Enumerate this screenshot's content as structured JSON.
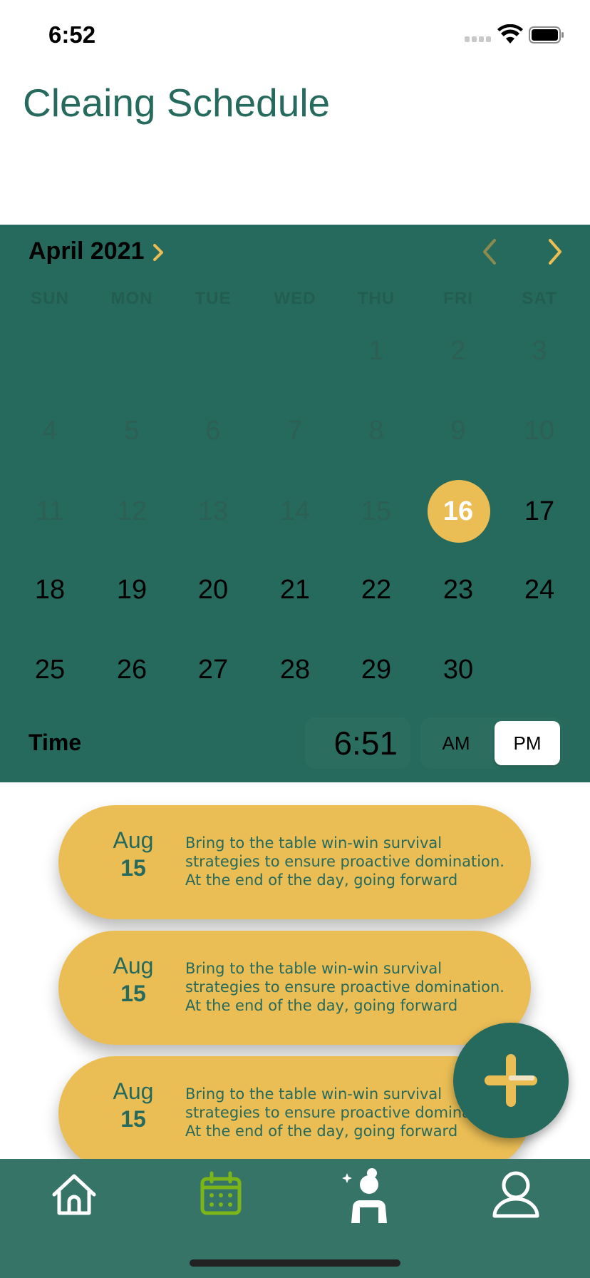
{
  "status_bar": {
    "time": "6:52"
  },
  "page_title": "Cleaing Schedule",
  "calendar": {
    "month_label": "April 2021",
    "weekdays": [
      "SUN",
      "MON",
      "TUE",
      "WED",
      "THU",
      "FRI",
      "SAT"
    ],
    "selected_day": "16",
    "weeks": [
      [
        "",
        "",
        "",
        "",
        "1",
        "2",
        "3"
      ],
      [
        "4",
        "5",
        "6",
        "7",
        "8",
        "9",
        "10"
      ],
      [
        "11",
        "12",
        "13",
        "14",
        "15",
        "16",
        "17"
      ],
      [
        "18",
        "19",
        "20",
        "21",
        "22",
        "23",
        "24"
      ],
      [
        "25",
        "26",
        "27",
        "28",
        "29",
        "30",
        ""
      ]
    ],
    "time_label": "Time",
    "time_value": "6:51",
    "am_label": "AM",
    "pm_label": "PM",
    "selected_period": "PM"
  },
  "tasks": [
    {
      "month": "Aug",
      "day": "15",
      "text": "Bring to the table win-win survival strategies to ensure proactive domination. At the end of the day, going forward"
    },
    {
      "month": "Aug",
      "day": "15",
      "text": "Bring to the table win-win survival strategies to ensure proactive domination. At the end of the day, going forward"
    },
    {
      "month": "Aug",
      "day": "15",
      "text": "Bring to the table win-win survival strategies to ensure proactive domination. At the end of the day, going forward"
    }
  ],
  "tab_bar": {
    "items": [
      {
        "icon": "home-icon"
      },
      {
        "icon": "calendar-icon",
        "active": true
      },
      {
        "icon": "cleaner-icon"
      },
      {
        "icon": "profile-icon"
      }
    ]
  },
  "colors": {
    "primary": "#256a5c",
    "accent": "#ebbe55",
    "tab_bar": "#367467",
    "active_tab": "#7cb518"
  }
}
